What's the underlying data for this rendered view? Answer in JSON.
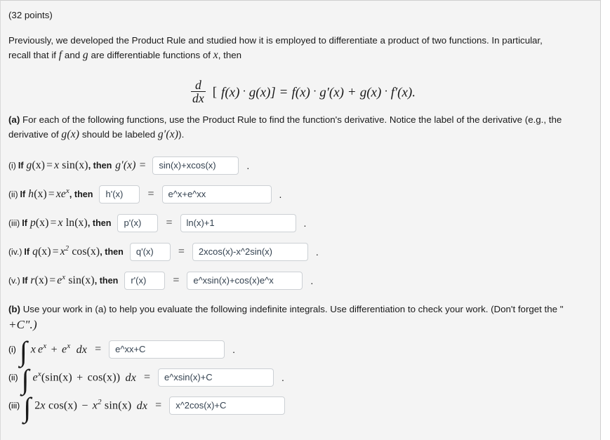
{
  "question": {
    "points_label": "(32 points)",
    "intro_text_1": "Previously, we developed the Product Rule and studied how it is employed to differentiate a product of two functions. In particular,",
    "intro_text_2_pre": "recall that if",
    "intro_f": "f",
    "intro_and": "and",
    "intro_g": "g",
    "intro_text_2_mid": "are differentiable functions of",
    "intro_x": "x",
    "intro_text_2_end": ", then",
    "formula": {
      "d": "d",
      "dx": "dx",
      "lhs_bracket_open": "[",
      "lhs_f": "f",
      "lhs_fx": "(x)",
      "dot1": "·",
      "lhs_g": "g",
      "lhs_gx": "(x)",
      "lhs_bracket_close": "]",
      "equals": "=",
      "rhs_f": "f",
      "rhs_fx": "(x)",
      "dot2": "·",
      "rhs_gp": "g",
      "rhs_gp_prime": "′",
      "rhs_gpx": "(x)",
      "plus": "+",
      "rhs_g": "g",
      "rhs_gx": "(x)",
      "dot3": "·",
      "rhs_fp": "f",
      "rhs_fp_prime": "′",
      "rhs_fpx": "(x).",
      "plain": "d/dx [f(x)·g(x)] = f(x)·g′(x) + g(x)·f′(x)."
    }
  },
  "part_a": {
    "label": "(a)",
    "text_line1": "For each of the following functions, use the Product Rule to find the function's derivative. Notice the label of the derivative (e.g., the",
    "text_line2_pre": "derivative of",
    "text_line2_g": "g(x)",
    "text_line2_mid": "should be labeled",
    "text_line2_gp": "g′(x)",
    "text_line2_end": ")."
  },
  "part_a_items": [
    {
      "number": "(i)",
      "if_word": "If",
      "function_def": "g(x) = x sin(x)",
      "fn_name": "g",
      "fn_arg": "(x)",
      "fn_body_pre": "x",
      "fn_body_op": "sin",
      "fn_body_arg": "(x)",
      "fn_body_sup": "",
      "then_word": ", then",
      "derivative_label_inline": "g′(x) =",
      "has_label_input": false,
      "label_input_value": "",
      "answer_value": "sin(x)+xcos(x)",
      "answer_width": "med",
      "trailing": "."
    },
    {
      "number": "(ii)",
      "if_word": "If",
      "function_def": "h(x) = xe^x",
      "fn_name": "h",
      "fn_arg": "(x)",
      "fn_body_pre": "xe",
      "fn_body_op": "",
      "fn_body_arg": "",
      "fn_body_sup": "x",
      "then_word": ", then",
      "derivative_label_inline": "",
      "has_label_input": true,
      "label_input_value": "h'(x)",
      "answer_value": "e^x+e^xx",
      "answer_width": "wide",
      "trailing": "."
    },
    {
      "number": "(iii)",
      "if_word": "If",
      "function_def": "p(x) = x ln(x)",
      "fn_name": "p",
      "fn_arg": "(x)",
      "fn_body_pre": "x",
      "fn_body_op": "ln",
      "fn_body_arg": "(x)",
      "fn_body_sup": "",
      "then_word": ", then",
      "derivative_label_inline": "",
      "has_label_input": true,
      "label_input_value": "p'(x)",
      "answer_value": "ln(x)+1",
      "answer_width": "xwide",
      "trailing": "."
    },
    {
      "number": "(iv.)",
      "if_word": "If",
      "function_def": "q(x) = x^2 cos(x)",
      "fn_name": "q",
      "fn_arg": "(x)",
      "fn_body_pre": "x",
      "fn_body_op": "cos",
      "fn_body_arg": "(x)",
      "fn_body_sup": "2",
      "then_word": ", then",
      "derivative_label_inline": "",
      "has_label_input": true,
      "label_input_value": "q'(x)",
      "answer_value": "2xcos(x)-x^2sin(x)",
      "answer_width": "xwide",
      "trailing": "."
    },
    {
      "number": "(v.)",
      "if_word": "If",
      "function_def": "r(x) = e^x sin(x)",
      "fn_name": "r",
      "fn_arg": "(x)",
      "fn_body_pre": "e",
      "fn_body_op": "sin",
      "fn_body_arg": "(x)",
      "fn_body_sup": "x",
      "then_word": ", then",
      "derivative_label_inline": "",
      "has_label_input": true,
      "label_input_value": "r'(x)",
      "answer_value": "e^xsin(x)+cos(x)e^x",
      "answer_width": "xwide",
      "trailing": "."
    }
  ],
  "part_b": {
    "label": "(b)",
    "text_line1": "Use your work in (a) to help you evaluate the following indefinite integrals. Use differentiation to check your work. (Don't forget the \"",
    "text_line2": "+C\".)"
  },
  "part_b_items": [
    {
      "number": "(i)",
      "integral_symbol": "∫",
      "integrand": "xe^x + e^x dx",
      "equals": "=",
      "answer_value": "e^xx+C",
      "answer_width": "xwide",
      "trailing": "."
    },
    {
      "number": "(ii)",
      "integral_symbol": "∫",
      "integrand": "e^x(sin(x) + cos(x)) dx",
      "equals": "=",
      "answer_value": "e^xsin(x)+C",
      "answer_width": "xwide",
      "trailing": "."
    },
    {
      "number": "(iii)",
      "integral_symbol": "∫",
      "integrand": "2x cos(x) − x^2 sin(x) dx",
      "equals": "=",
      "answer_value": "x^2cos(x)+C",
      "answer_width": "xwide",
      "trailing": ""
    }
  ],
  "colors": {
    "page_background": "#f4f4f4",
    "input_background": "#ffffff",
    "input_border": "#ccd0d4",
    "input_text": "#33414f",
    "body_text": "#1a1a1a"
  }
}
